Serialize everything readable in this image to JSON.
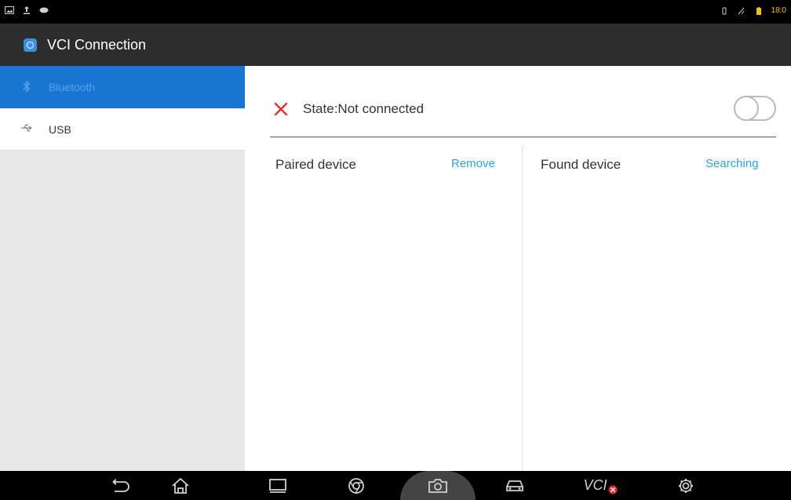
{
  "status_bar": {
    "left_icons": [
      "image-icon",
      "upload-icon",
      "gamepad-icon"
    ],
    "right_icons": [
      "vibrate-icon",
      "signal-icon",
      "battery-icon"
    ],
    "time": "18:0"
  },
  "app_bar": {
    "icon": "vci-app-icon",
    "title": "VCI Connection"
  },
  "sidebar": {
    "items": [
      {
        "icon": "bluetooth-icon",
        "label": "Bluetooth",
        "active": true
      },
      {
        "icon": "usb-icon",
        "label": "USB",
        "active": false
      }
    ]
  },
  "main": {
    "state": {
      "icon": "close-icon",
      "text": "State:Not connected",
      "toggle_on": false
    },
    "paired": {
      "title": "Paired device",
      "action": "Remove"
    },
    "found": {
      "title": "Found device",
      "action": "Searching"
    }
  },
  "nav_bar": {
    "buttons": [
      "back-icon",
      "home-icon",
      "recents-icon",
      "browser-icon",
      "camera-icon",
      "car-icon",
      "vci-icon",
      "settings-icon"
    ],
    "vci_label": "VCI"
  },
  "colors": {
    "accent": "#1976d2",
    "link": "#2ba3d9",
    "error": "#e03131"
  }
}
